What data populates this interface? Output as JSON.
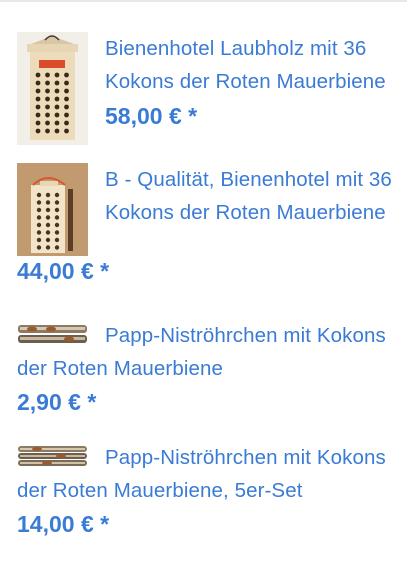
{
  "products": [
    {
      "title": "Bienenhotel Laubholz mit 36 Kokons der Roten Mauerbiene",
      "price": "58,00 € *",
      "image_icon": "bee-hotel-light-wood-icon"
    },
    {
      "title": "B - Qualität, Bienenhotel mit 36 Kokons der Roten Mauerbiene",
      "price": "44,00 € *",
      "image_icon": "bee-hotel-b-quality-icon"
    },
    {
      "title": "Papp-Niströhrchen mit Kokons der Roten Mauerbiene",
      "price": "2,90 € *",
      "image_icon": "nesting-tube-icon"
    },
    {
      "title": "Papp-Niströhrchen mit Kokons der Roten Mauerbiene, 5er-Set",
      "price": "14,00 € *",
      "image_icon": "nesting-tubes-set-icon"
    }
  ],
  "colors": {
    "link": "#3a7bd5",
    "background": "#ffffff"
  }
}
